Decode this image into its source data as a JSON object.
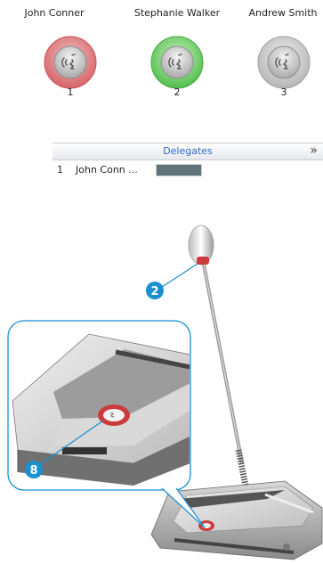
{
  "delegates": [
    {
      "name": "John Conner",
      "number": "1",
      "state": "red",
      "color": "#d9666a"
    },
    {
      "name": "Stephanie Walker",
      "number": "2",
      "state": "green",
      "color": "#5fc85a"
    },
    {
      "name": "Andrew Smith",
      "number": "3",
      "state": "grey",
      "color": "#bcbcbc"
    }
  ],
  "panel": {
    "title": "Delegates",
    "collapse_icon": "double-chevron-up-icon",
    "row": {
      "number": "1",
      "name": "John Conn ..."
    }
  },
  "callouts": [
    {
      "number": "2",
      "target": "microphone-tip-ring"
    },
    {
      "number": "8",
      "target": "speak-button"
    }
  ],
  "colors": {
    "callout": "#1a8fd1",
    "accent_link": "#3366cc",
    "status_bar": "#5f7378"
  }
}
